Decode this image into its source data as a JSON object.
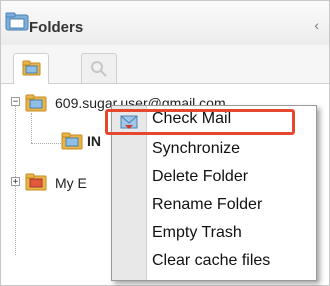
{
  "header": {
    "title": "Folders",
    "collapse_glyph": "‹"
  },
  "tabs": [
    {
      "icon": "folder-icon",
      "active": true
    },
    {
      "icon": "search-icon",
      "active": false
    }
  ],
  "tree": {
    "root_account": {
      "expander": "−",
      "label": "609.sugar.user@gmail.com"
    },
    "inbox": {
      "label": "IN"
    },
    "second_account": {
      "expander": "+",
      "label": "My E"
    }
  },
  "context_menu": {
    "items": [
      "Check Mail",
      "Synchronize",
      "Delete Folder",
      "Rename Folder",
      "Empty Trash",
      "Clear cache files"
    ],
    "highlight_color": "#e5482f"
  },
  "colors": {
    "folder": "#e8b54a",
    "folder_dark": "#c98a1c",
    "mail_blue": "#6aa8d8"
  }
}
